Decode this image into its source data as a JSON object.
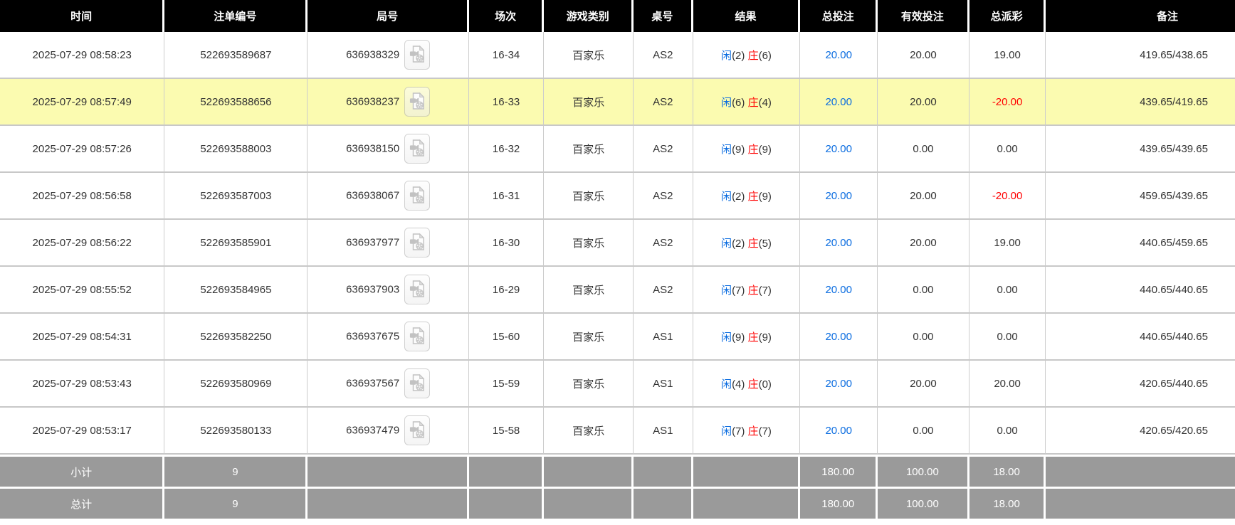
{
  "colors": {
    "header_bg": "#000000",
    "header_text": "#ffffff",
    "highlight": "#fbfbb0",
    "summary_bg": "#9a9a9a",
    "blue": "#0a6ce0",
    "red": "#ff0000",
    "text": "#333333",
    "border_v": "#cccccc",
    "border_h": "#c8c8c8"
  },
  "icons": {
    "video_replay": "video-file-icon"
  },
  "table": {
    "columns": [
      {
        "key": "time",
        "label": "时间"
      },
      {
        "key": "bet_id",
        "label": "注单编号"
      },
      {
        "key": "round",
        "label": "局号"
      },
      {
        "key": "session",
        "label": "场次"
      },
      {
        "key": "game_type",
        "label": "游戏类别"
      },
      {
        "key": "table_no",
        "label": "桌号"
      },
      {
        "key": "result",
        "label": "结果"
      },
      {
        "key": "total_bet",
        "label": "总投注"
      },
      {
        "key": "valid_bet",
        "label": "有效投注"
      },
      {
        "key": "payout",
        "label": "总派彩"
      },
      {
        "key": "remark",
        "label": "备注"
      }
    ],
    "rows": [
      {
        "time": "2025-07-29 08:58:23",
        "bet_id": "522693589687",
        "round": "636938329",
        "session": "16-34",
        "game_type": "百家乐",
        "table_no": "AS2",
        "result": {
          "player_label": "闲",
          "player_score": "(2)",
          "banker_label": "庄",
          "banker_score": "(6)"
        },
        "total_bet": "20.00",
        "valid_bet": "20.00",
        "payout": "19.00",
        "remark": "419.65/438.65",
        "highlighted": false
      },
      {
        "time": "2025-07-29 08:57:49",
        "bet_id": "522693588656",
        "round": "636938237",
        "session": "16-33",
        "game_type": "百家乐",
        "table_no": "AS2",
        "result": {
          "player_label": "闲",
          "player_score": "(6)",
          "banker_label": "庄",
          "banker_score": "(4)"
        },
        "total_bet": "20.00",
        "valid_bet": "20.00",
        "payout": "-20.00",
        "remark": "439.65/419.65",
        "highlighted": true
      },
      {
        "time": "2025-07-29 08:57:26",
        "bet_id": "522693588003",
        "round": "636938150",
        "session": "16-32",
        "game_type": "百家乐",
        "table_no": "AS2",
        "result": {
          "player_label": "闲",
          "player_score": "(9)",
          "banker_label": "庄",
          "banker_score": "(9)"
        },
        "total_bet": "20.00",
        "valid_bet": "0.00",
        "payout": "0.00",
        "remark": "439.65/439.65",
        "highlighted": false
      },
      {
        "time": "2025-07-29 08:56:58",
        "bet_id": "522693587003",
        "round": "636938067",
        "session": "16-31",
        "game_type": "百家乐",
        "table_no": "AS2",
        "result": {
          "player_label": "闲",
          "player_score": "(2)",
          "banker_label": "庄",
          "banker_score": "(9)"
        },
        "total_bet": "20.00",
        "valid_bet": "20.00",
        "payout": "-20.00",
        "remark": "459.65/439.65",
        "highlighted": false
      },
      {
        "time": "2025-07-29 08:56:22",
        "bet_id": "522693585901",
        "round": "636937977",
        "session": "16-30",
        "game_type": "百家乐",
        "table_no": "AS2",
        "result": {
          "player_label": "闲",
          "player_score": "(2)",
          "banker_label": "庄",
          "banker_score": "(5)"
        },
        "total_bet": "20.00",
        "valid_bet": "20.00",
        "payout": "19.00",
        "remark": "440.65/459.65",
        "highlighted": false
      },
      {
        "time": "2025-07-29 08:55:52",
        "bet_id": "522693584965",
        "round": "636937903",
        "session": "16-29",
        "game_type": "百家乐",
        "table_no": "AS2",
        "result": {
          "player_label": "闲",
          "player_score": "(7)",
          "banker_label": "庄",
          "banker_score": "(7)"
        },
        "total_bet": "20.00",
        "valid_bet": "0.00",
        "payout": "0.00",
        "remark": "440.65/440.65",
        "highlighted": false
      },
      {
        "time": "2025-07-29 08:54:31",
        "bet_id": "522693582250",
        "round": "636937675",
        "session": "15-60",
        "game_type": "百家乐",
        "table_no": "AS1",
        "result": {
          "player_label": "闲",
          "player_score": "(9)",
          "banker_label": "庄",
          "banker_score": "(9)"
        },
        "total_bet": "20.00",
        "valid_bet": "0.00",
        "payout": "0.00",
        "remark": "440.65/440.65",
        "highlighted": false
      },
      {
        "time": "2025-07-29 08:53:43",
        "bet_id": "522693580969",
        "round": "636937567",
        "session": "15-59",
        "game_type": "百家乐",
        "table_no": "AS1",
        "result": {
          "player_label": "闲",
          "player_score": "(4)",
          "banker_label": "庄",
          "banker_score": "(0)"
        },
        "total_bet": "20.00",
        "valid_bet": "20.00",
        "payout": "20.00",
        "remark": "420.65/440.65",
        "highlighted": false
      },
      {
        "time": "2025-07-29 08:53:17",
        "bet_id": "522693580133",
        "round": "636937479",
        "session": "15-58",
        "game_type": "百家乐",
        "table_no": "AS1",
        "result": {
          "player_label": "闲",
          "player_score": "(7)",
          "banker_label": "庄",
          "banker_score": "(7)"
        },
        "total_bet": "20.00",
        "valid_bet": "0.00",
        "payout": "0.00",
        "remark": "420.65/420.65",
        "highlighted": false
      }
    ],
    "summary": [
      {
        "label": "小计",
        "count": "9",
        "total_bet": "180.00",
        "valid_bet": "100.00",
        "payout": "18.00"
      },
      {
        "label": "总计",
        "count": "9",
        "total_bet": "180.00",
        "valid_bet": "100.00",
        "payout": "18.00"
      }
    ]
  }
}
